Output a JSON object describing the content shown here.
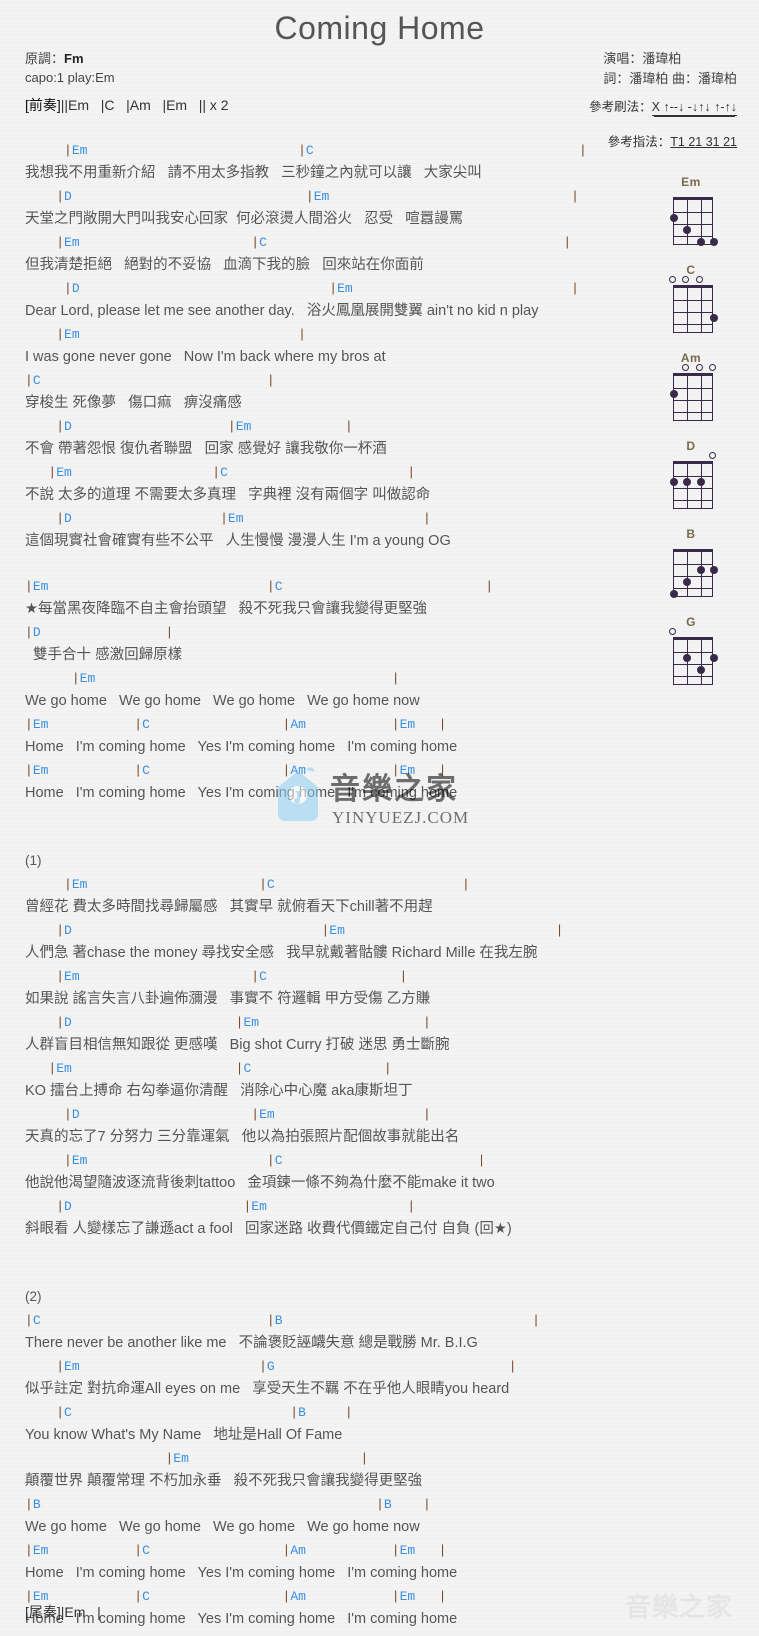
{
  "header": {
    "title": "Coming Home",
    "orig_key_label": "原調：",
    "orig_key": "Fm",
    "capo_line": "capo:1 play:Em",
    "singer": "演唱：潘瑋柏",
    "credits": "詞：潘瑋柏  曲：潘瑋柏",
    "strum_label": "參考刷法：",
    "strum_pattern": "X ↑--↓ -↓↑↓ ↑-↑↓",
    "pick_label": "參考指法：",
    "pick_pattern": "T1 21 31 21"
  },
  "intro": {
    "section": "[前奏]",
    "line": "||Em   |C   |Am   |Em   || x 2"
  },
  "outro": {
    "section": "[尾奏]",
    "line": "|Em   |"
  },
  "colors": {
    "chord": "#3b8fe0",
    "barline": "#7a4a2a",
    "lyric": "#555555",
    "title": "#555555",
    "diagram": "#3a2a4a",
    "diagram_label": "#7a6a4a",
    "watermark": "#7ec8ee"
  },
  "sections": [
    {
      "name": "verse-a",
      "lines": [
        {
          "type": "chord",
          "text": "     |Em                           |C                                  |"
        },
        {
          "type": "lyric",
          "text": "我想我不用重新介紹   請不用太多指教   三秒鐘之內就可以讓   大家尖叫"
        },
        {
          "type": "chord",
          "text": "    |D                              |Em                               |"
        },
        {
          "type": "lyric",
          "text": "天堂之門敞開大門叫我安心回家  何必滾燙人間浴火   忍受   喧囂謾罵"
        },
        {
          "type": "chord",
          "text": "    |Em                      |C                                      |"
        },
        {
          "type": "lyric",
          "text": "但我清楚拒絕   絕對的不妥協   血滴下我的臉   回來站在你面前"
        },
        {
          "type": "chord",
          "text": "     |D                                |Em                            |"
        },
        {
          "type": "lyric",
          "text": "Dear Lord, please let me see another day.   浴火鳳凰展開雙翼 ain't no kid n play"
        },
        {
          "type": "chord",
          "text": "    |Em                            |"
        },
        {
          "type": "lyric",
          "text": "I was gone never gone   Now I'm back where my bros at"
        },
        {
          "type": "chord",
          "text": "|C                             |"
        },
        {
          "type": "lyric",
          "text": "穿梭生 死像夢   傷口痲   痹沒痛感"
        },
        {
          "type": "chord",
          "text": "    |D                    |Em            |"
        },
        {
          "type": "lyric",
          "text": "不會 帶著怨恨 復仇者聯盟   回家 感覺好 讓我敬你一杯酒"
        },
        {
          "type": "chord",
          "text": "   |Em                  |C                       |"
        },
        {
          "type": "lyric",
          "text": "不說 太多的道理 不需要太多真理   字典裡 沒有兩個字 叫做認命"
        },
        {
          "type": "chord",
          "text": "    |D                   |Em                       |"
        },
        {
          "type": "lyric",
          "text": "這個現實社會確實有些不公平   人生慢慢 漫漫人生 I'm a young OG"
        }
      ]
    },
    {
      "name": "chorus",
      "lines": [
        {
          "type": "blank",
          "text": ""
        },
        {
          "type": "chord",
          "text": "|Em                            |C                          |"
        },
        {
          "type": "lyric",
          "text": "★每當黑夜降臨不自主會抬頭望   殺不死我只會讓我變得更堅強"
        },
        {
          "type": "chord",
          "text": "|D                |"
        },
        {
          "type": "lyric",
          "text": "  雙手合十 感激回歸原樣"
        },
        {
          "type": "chord",
          "text": "      |Em                                      |"
        },
        {
          "type": "lyric",
          "text": "We go home   We go home   We go home   We go home now"
        },
        {
          "type": "chord",
          "text": "|Em           |C                 |Am           |Em   |"
        },
        {
          "type": "lyric",
          "text": "Home   I'm coming home   Yes I'm coming home   I'm coming home"
        },
        {
          "type": "chord",
          "text": "|Em           |C                 |Am           |Em   |"
        },
        {
          "type": "lyric",
          "text": "Home   I'm coming home   Yes I'm coming home   I'm coming home"
        }
      ]
    },
    {
      "name": "verse-1",
      "lines": [
        {
          "type": "blank",
          "text": ""
        },
        {
          "type": "blank",
          "text": ""
        },
        {
          "type": "label",
          "text": "(1)"
        },
        {
          "type": "chord",
          "text": "     |Em                      |C                        |"
        },
        {
          "type": "lyric",
          "text": "曾經花 費太多時間找尋歸屬感   其實早 就俯看天下chill著不用趕"
        },
        {
          "type": "chord",
          "text": "    |D                                |Em                           |"
        },
        {
          "type": "lyric",
          "text": "人們急 著chase the money 尋找安全感   我早就戴著骷髏 Richard Mille 在我左腕"
        },
        {
          "type": "chord",
          "text": "    |Em                      |C                 |"
        },
        {
          "type": "lyric",
          "text": "如果說 謠言失言八卦遍佈瀰漫   事實不 符邏輯 甲方受傷 乙方賺"
        },
        {
          "type": "chord",
          "text": "    |D                     |Em                     |"
        },
        {
          "type": "lyric",
          "text": "人群盲目相信無知跟從 更感嘆   Big shot Curry 打破 迷思 勇士斷腕"
        },
        {
          "type": "chord",
          "text": "   |Em                     |C                 |"
        },
        {
          "type": "lyric",
          "text": "KO 擂台上搏命 右勾拳逼你清醒   消除心中心魔 aka康斯坦丁"
        },
        {
          "type": "chord",
          "text": "     |D                      |Em                   |"
        },
        {
          "type": "lyric",
          "text": "天真的忘了7 分努力 三分靠運氣   他以為拍張照片配個故事就能出名"
        },
        {
          "type": "chord",
          "text": "     |Em                       |C                         |"
        },
        {
          "type": "lyric",
          "text": "他說他渴望隨波逐流背後刺tattoo   金項鍊一條不夠為什麼不能make it two"
        },
        {
          "type": "chord",
          "text": "    |D                      |Em                  |"
        },
        {
          "type": "lyric",
          "text": "斜眼看 人變樣忘了謙遜act a fool   回家迷路 收費代價鐵定自己付 自負 (回★)"
        }
      ]
    },
    {
      "name": "verse-2",
      "lines": [
        {
          "type": "blank",
          "text": ""
        },
        {
          "type": "blank",
          "text": ""
        },
        {
          "type": "label",
          "text": "(2)"
        },
        {
          "type": "chord",
          "text": "|C                             |B                                |"
        },
        {
          "type": "lyric",
          "text": "There never be another like me   不論褒貶誣衊失意 總是戰勝 Mr. B.I.G"
        },
        {
          "type": "chord",
          "text": "    |Em                       |G                              |"
        },
        {
          "type": "lyric",
          "text": "似乎註定 對抗命運All eyes on me   享受天生不羈 不在乎他人眼睛you heard"
        },
        {
          "type": "chord",
          "text": "    |C                            |B     |"
        },
        {
          "type": "lyric",
          "text": "You know What's My Name   地址是Hall Of Fame"
        },
        {
          "type": "chord",
          "text": "                  |Em                      |"
        },
        {
          "type": "lyric",
          "text": "顛覆世界 顛覆常理 不朽加永垂   殺不死我只會讓我變得更堅強"
        },
        {
          "type": "chord",
          "text": "|B                                           |B    |"
        },
        {
          "type": "lyric",
          "text": "We go home   We go home   We go home   We go home now"
        },
        {
          "type": "chord",
          "text": "|Em           |C                 |Am           |Em   |"
        },
        {
          "type": "lyric",
          "text": "Home   I'm coming home   Yes I'm coming home   I'm coming home"
        },
        {
          "type": "chord",
          "text": "|Em           |C                 |Am           |Em   |"
        },
        {
          "type": "lyric",
          "text": "Home   I'm coming home   Yes I'm coming home   I'm coming home"
        }
      ]
    }
  ],
  "chord_diagrams": [
    {
      "name": "Em",
      "open_strings": [],
      "dots": [
        {
          "string": 1,
          "fret": 2
        },
        {
          "string": 2,
          "fret": 3
        },
        {
          "string": 3,
          "fret": 4
        },
        {
          "string": 4,
          "fret": 4
        }
      ]
    },
    {
      "name": "C",
      "open_strings": [
        1,
        2,
        3
      ],
      "dots": [
        {
          "string": 4,
          "fret": 3
        }
      ]
    },
    {
      "name": "Am",
      "open_strings": [
        2,
        3,
        4
      ],
      "dots": [
        {
          "string": 1,
          "fret": 2
        }
      ]
    },
    {
      "name": "D",
      "open_strings": [
        4
      ],
      "dots": [
        {
          "string": 1,
          "fret": 2
        },
        {
          "string": 2,
          "fret": 2
        },
        {
          "string": 3,
          "fret": 2
        }
      ]
    },
    {
      "name": "B",
      "open_strings": [],
      "dots": [
        {
          "string": 1,
          "fret": 4
        },
        {
          "string": 2,
          "fret": 3
        },
        {
          "string": 3,
          "fret": 2
        },
        {
          "string": 4,
          "fret": 2
        }
      ]
    },
    {
      "name": "G",
      "open_strings": [
        1
      ],
      "dots": [
        {
          "string": 2,
          "fret": 2
        },
        {
          "string": 3,
          "fret": 3
        },
        {
          "string": 4,
          "fret": 2
        }
      ]
    }
  ],
  "watermark": {
    "cn": "音樂之家",
    "url": "YINYUEZJ.COM"
  }
}
